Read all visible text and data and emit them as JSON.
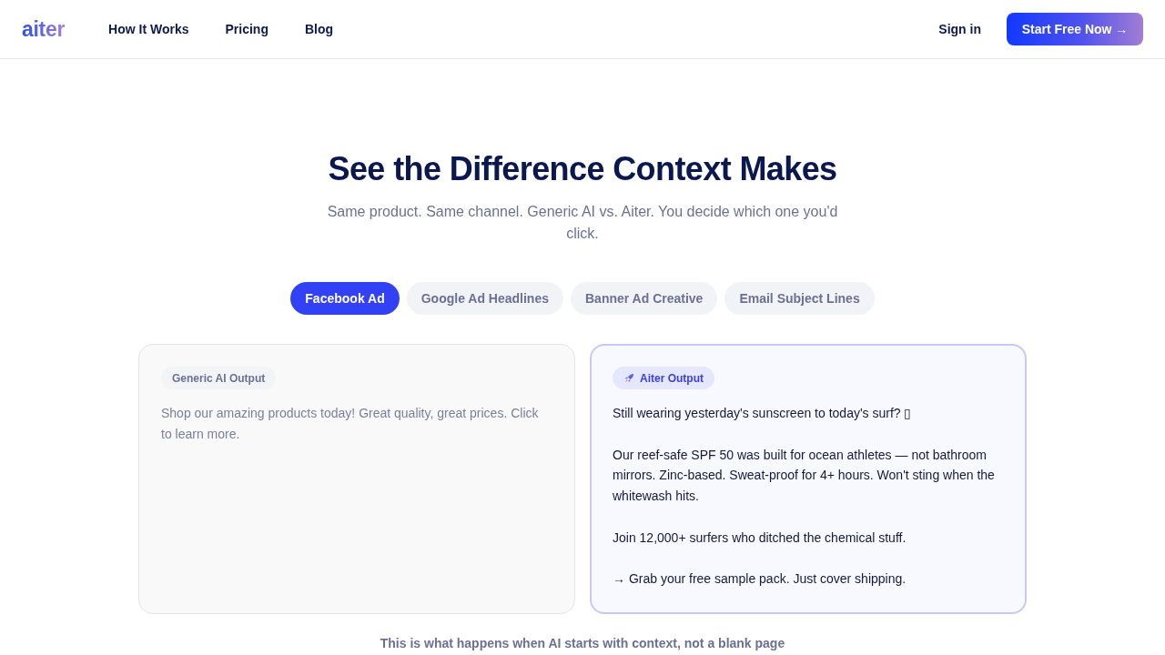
{
  "nav": {
    "logo": "aiter",
    "links": [
      {
        "label": "How It Works"
      },
      {
        "label": "Pricing"
      },
      {
        "label": "Blog"
      }
    ],
    "sign_in": "Sign in",
    "cta": "Start Free Now →"
  },
  "hero": {
    "title": "See the Difference Context Makes",
    "subtitle": "Same product. Same channel. Generic AI vs. Aiter. You decide which one you'd click."
  },
  "tabs": [
    {
      "label": "Facebook Ad",
      "selected": true
    },
    {
      "label": "Google Ad Headlines",
      "selected": false
    },
    {
      "label": "Banner Ad Creative",
      "selected": false
    },
    {
      "label": "Email Subject Lines",
      "selected": false
    }
  ],
  "cards": [
    {
      "kind": "generic",
      "badge": "Generic AI Output",
      "paragraphs": [
        "Shop our amazing products today! Great quality, great prices. Click to learn more."
      ]
    },
    {
      "kind": "aiter",
      "badge": "Aiter Output",
      "paragraphs": [
        "Still wearing yesterday's sunscreen to today's surf? ▯",
        "Our reef-safe SPF 50 was built for ocean athletes — not bathroom mirrors. Zinc-based. Sweat-proof for 4+ hours. Won't sting when the whitewash hits.",
        "Join 12,000+ surfers who ditched the chemical stuff.",
        "→ Grab your free sample pack. Just cover shipping."
      ]
    }
  ],
  "footnote": "This is what happens when AI starts with context, not a blank page"
}
